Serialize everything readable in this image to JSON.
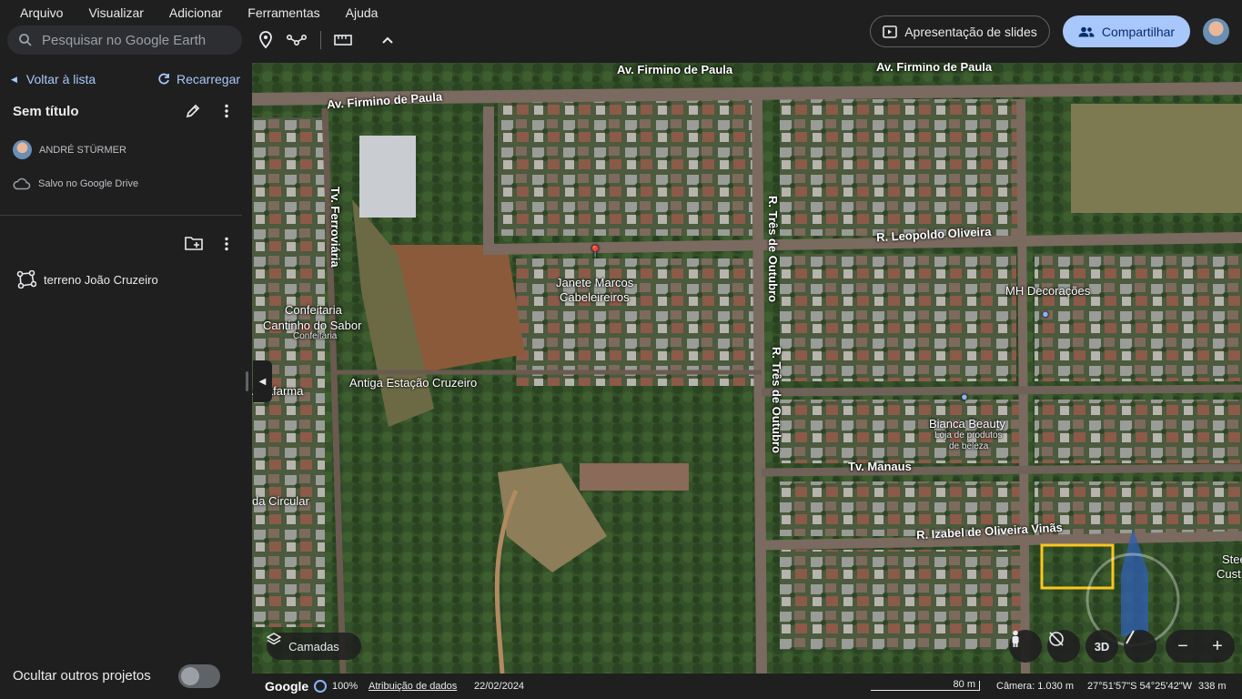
{
  "menu": [
    "Arquivo",
    "Visualizar",
    "Adicionar",
    "Ferramentas",
    "Ajuda"
  ],
  "search": {
    "placeholder": "Pesquisar no Google Earth"
  },
  "header": {
    "slides_label": "Apresentação de slides",
    "share_label": "Compartilhar"
  },
  "panel": {
    "back_label": "Voltar à lista",
    "reload_label": "Recarregar",
    "project_title": "Sem título",
    "owner": "ANDRÉ STÜRMER",
    "saved": "Salvo no Google Drive",
    "item": "terreno João Cruzeiro",
    "hide_label": "Ocultar outros projetos"
  },
  "map": {
    "roads": {
      "firmino_top1": "Av. Firmino de Paula",
      "firmino_top2": "Av. Firmino de Paula",
      "firmino_left": "Av. Firmino de Paula",
      "ferroviaria": "Tv. Ferroviária",
      "tres_outubro1": "R. Três de Outubro",
      "tres_outubro2": "R. Três de Outubro",
      "leopoldo": "R. Leopoldo Oliveira",
      "manaus": "Tv. Manaus",
      "izabel": "R. Izabel de Oliveira Vinãs"
    },
    "places": {
      "janete1": "Janete Marcos",
      "janete2": "Cabeleireiros",
      "mh": "MH Decorações",
      "confeitaria1": "Confeitaria",
      "confeitaria2": "Cantinho do Sabor",
      "confeitaria3": "Confeitaria",
      "estacao": "Antiga Estação Cruzeiro",
      "agafarma": "Agafarma",
      "bianca1": "Bianca Beauty",
      "bianca2": "Loja de produtos",
      "bianca3": "de beleza",
      "circular": "da Circular",
      "steel1": "Stee",
      "steel2": "Cust"
    },
    "layers_label": "Camadas",
    "view_3d": "3D",
    "zoom_out": "−",
    "zoom_in": "+"
  },
  "status": {
    "brand": "Google",
    "load_percent": "100%",
    "attribution": "Atribuição de dados",
    "date": "22/02/2024",
    "scale": "80 m",
    "camera": "Câmera: 1.030 m",
    "coords": "27°51'57\"S 54°25'42\"W",
    "altitude": "338 m"
  },
  "colors": {
    "accent": "#a8c7fa",
    "highlight_box": "#f9c61c"
  }
}
